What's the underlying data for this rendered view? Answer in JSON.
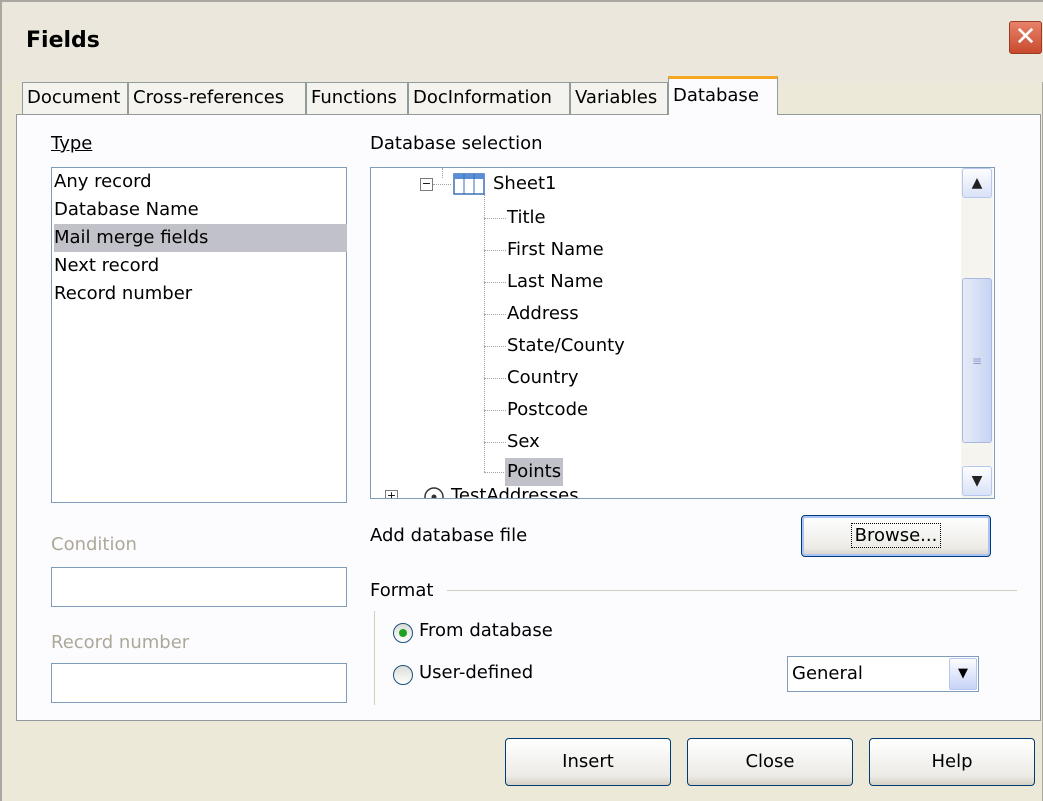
{
  "window": {
    "title": "Fields",
    "close_glyph": "✕"
  },
  "tabs": [
    {
      "label": "Document"
    },
    {
      "label": "Cross-references"
    },
    {
      "label": "Functions"
    },
    {
      "label": "DocInformation"
    },
    {
      "label": "Variables"
    },
    {
      "label": "Database",
      "active": true
    }
  ],
  "type_section": {
    "label": "Type",
    "items": [
      "Any record",
      "Database Name",
      "Mail merge fields",
      "Next record",
      "Record number"
    ],
    "selected": "Mail merge fields"
  },
  "condition": {
    "label": "Condition",
    "value": ""
  },
  "record_number": {
    "label": "Record number",
    "value": ""
  },
  "database_selection": {
    "label": "Database selection",
    "table": "Sheet1",
    "fields": [
      "Title",
      "First Name",
      "Last Name",
      "Address",
      "State/County",
      "Country",
      "Postcode",
      "Sex",
      "Points"
    ],
    "selected_field": "Points",
    "next_node": "TestAddresses"
  },
  "add_database": {
    "label": "Add database file",
    "browse_label": "Browse..."
  },
  "format": {
    "label": "Format",
    "from_database": "From database",
    "user_defined": "User-defined",
    "selected": "From database",
    "format_value": "General"
  },
  "buttons": {
    "insert": "Insert",
    "close": "Close",
    "help": "Help"
  },
  "colors": {
    "accent_tab": "#f5a623",
    "selection": "#c1c1c9",
    "radio_dot": "#21a121"
  }
}
